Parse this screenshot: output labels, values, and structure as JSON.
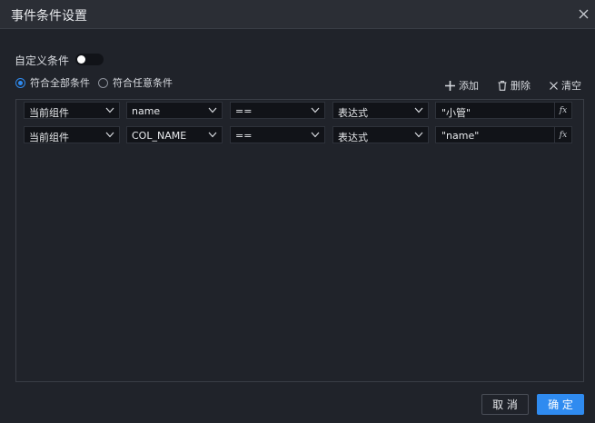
{
  "dialog": {
    "title": "事件条件设置"
  },
  "custom_condition": {
    "label": "自定义条件",
    "enabled": false
  },
  "match_mode": {
    "options": [
      {
        "label": "符合全部条件",
        "selected": true
      },
      {
        "label": "符合任意条件",
        "selected": false
      }
    ]
  },
  "toolbar": {
    "add_label": "添加",
    "delete_label": "删除",
    "clear_label": "清空"
  },
  "conditions": [
    {
      "source": "当前组件",
      "field": "name",
      "operator": "==",
      "value_type": "表达式",
      "value": "\"小管\"",
      "fx": "fx"
    },
    {
      "source": "当前组件",
      "field": "COL_NAME",
      "operator": "==",
      "value_type": "表达式",
      "value": "\"name\"",
      "fx": "fx"
    }
  ],
  "footer": {
    "cancel_label": "取 消",
    "ok_label": "确 定"
  },
  "colors": {
    "accent": "#2f8bf0",
    "background": "#20232a",
    "input_bg": "#111318"
  }
}
